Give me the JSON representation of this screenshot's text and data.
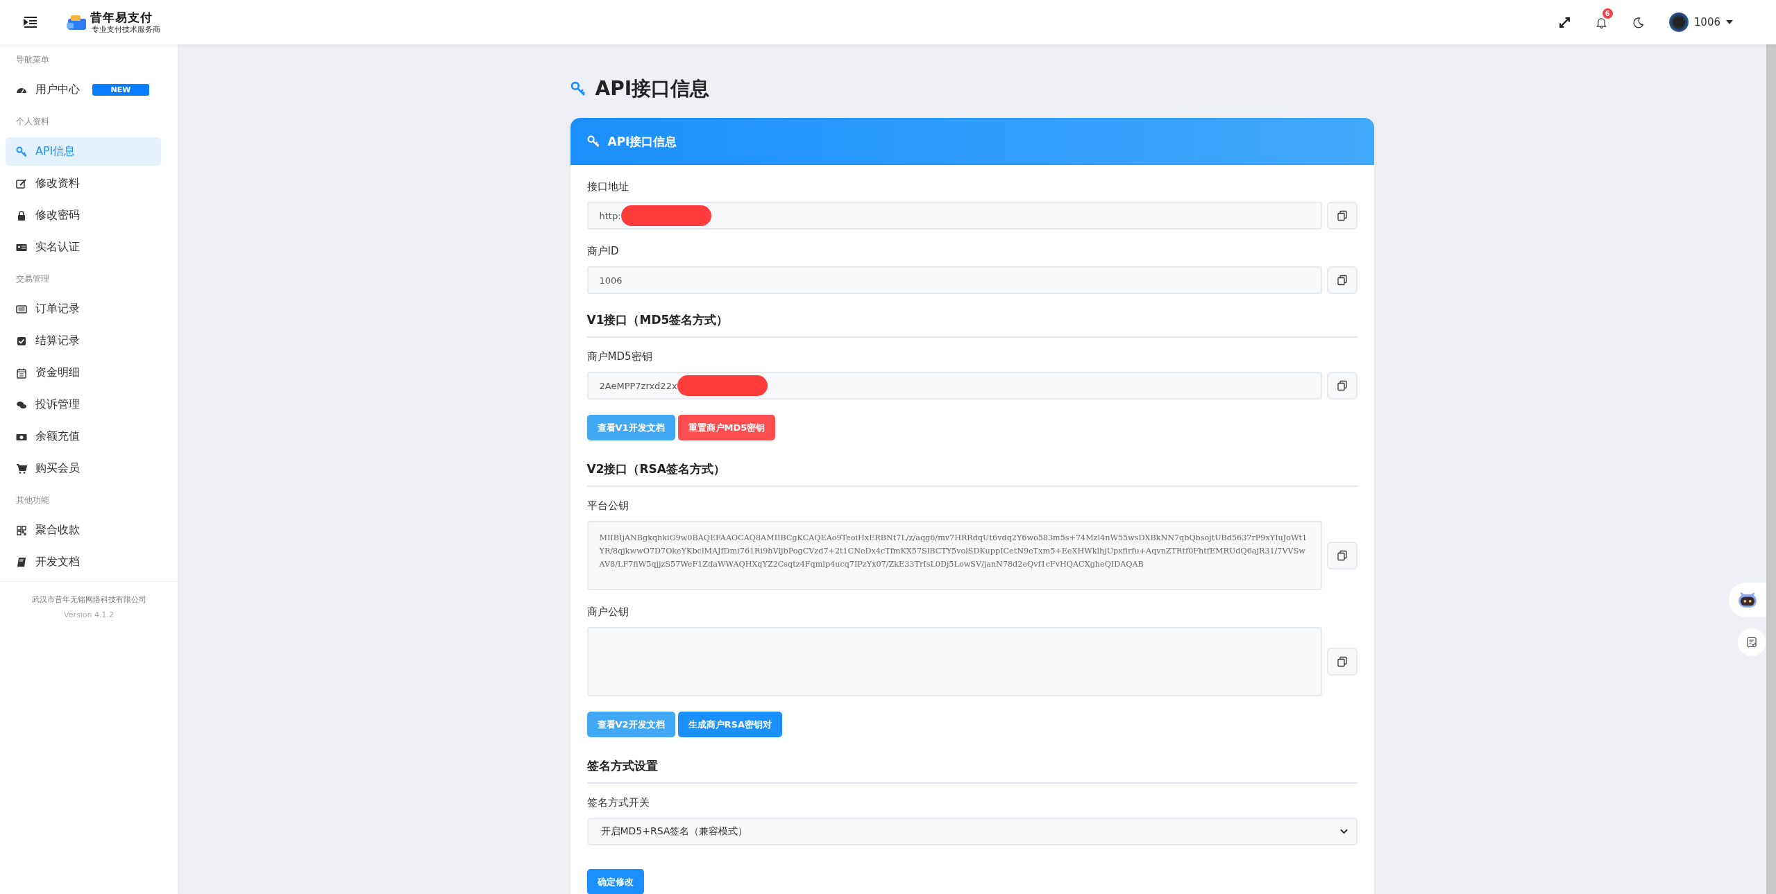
{
  "header": {
    "logo": {
      "title": "昔年易支付",
      "subtitle": "专业支付技术服务商"
    },
    "notification_count": "6",
    "user": "1006"
  },
  "sidebar": {
    "groups": [
      {
        "heading": "导航菜单",
        "items": [
          {
            "label": "用户中心",
            "selected": false,
            "badge": "NEW"
          }
        ]
      },
      {
        "heading": "个人资料",
        "items": [
          {
            "label": "API信息",
            "selected": true
          },
          {
            "label": "修改资料",
            "selected": false
          },
          {
            "label": "修改密码",
            "selected": false
          },
          {
            "label": "实名认证",
            "selected": false
          }
        ]
      },
      {
        "heading": "交易管理",
        "items": [
          {
            "label": "订单记录",
            "selected": false
          },
          {
            "label": "结算记录",
            "selected": false
          },
          {
            "label": "资金明细",
            "selected": false
          },
          {
            "label": "投诉管理",
            "selected": false
          },
          {
            "label": "余额充值",
            "selected": false
          },
          {
            "label": "购买会员",
            "selected": false
          }
        ]
      },
      {
        "heading": "其他功能",
        "items": [
          {
            "label": "聚合收款",
            "selected": false
          },
          {
            "label": "开发文档",
            "selected": false
          }
        ]
      }
    ],
    "footer": {
      "company": "武汉市昔年无铭网络科技有限公司",
      "version": "Version 4.1.2"
    }
  },
  "page_title": "API接口信息",
  "card": {
    "title": "API接口信息",
    "blocks": [
      {
        "kind": "field",
        "label": "接口地址",
        "value": "http:",
        "redacted": true
      },
      {
        "kind": "field",
        "label": "商户ID",
        "value": "1006",
        "redacted": false
      },
      {
        "kind": "heading",
        "text": "V1接口（MD5签名方式）"
      },
      {
        "kind": "field",
        "label": "商户MD5密钥",
        "value": "2AeMPP7zrxd22x",
        "redacted": true
      },
      {
        "kind": "buttons",
        "buttons": [
          {
            "label": "查看V1开发文档",
            "kind": "info"
          },
          {
            "label": "重置商户MD5密钥",
            "kind": "danger"
          }
        ]
      },
      {
        "kind": "heading",
        "text": "V2接口（RSA签名方式）"
      },
      {
        "kind": "textarea",
        "label": "平台公钥",
        "value": "MIIBIjANBgkqhkiG9w0BAQEFAAOCAQ8AMIIBCgKCAQEAo9TeoiHxERBNt7L/z/aqg6/mv7HRRdqUt6vdq2Y6wo583m5s+74Mzl4nW55wsDXBkNN7qbQbsojtUBd5637rP9xYIuJoWt1YR/8qjkwwO7D7OkeYKbclMAJfDmi761Ri9hVljbPogCVzd7+2t1CNeDx4cTfmKX57SlBCTY5volSDKuppICetN9eTxm5+EeXHWklhjUpxfirfu+AqvnZTRtf0FhtfEMRUdQ6ajR31/7VVSwAV8/LF7fiW5qjjzS57WeF1ZdaWWAQHXqYZ2Csqtz4Fqmip4ucq7IPzYx07/ZkE33TrIsL0Dj5LowSV/janN78d2eQvf1cFvHQACXgheQIDAQAB"
      },
      {
        "kind": "textarea",
        "label": "商户公钥"
      },
      {
        "kind": "buttons",
        "buttons": [
          {
            "label": "查看V2开发文档",
            "kind": "info"
          },
          {
            "label": "生成商户RSA密钥对",
            "kind": "primary"
          }
        ]
      },
      {
        "kind": "heading",
        "text": "签名方式设置"
      },
      {
        "kind": "select",
        "label": "签名方式开关",
        "value": "开启MD5+RSA签名（兼容模式）"
      },
      {
        "kind": "buttons",
        "buttons": [
          {
            "label": "确定修改",
            "kind": "primary"
          }
        ]
      }
    ]
  }
}
